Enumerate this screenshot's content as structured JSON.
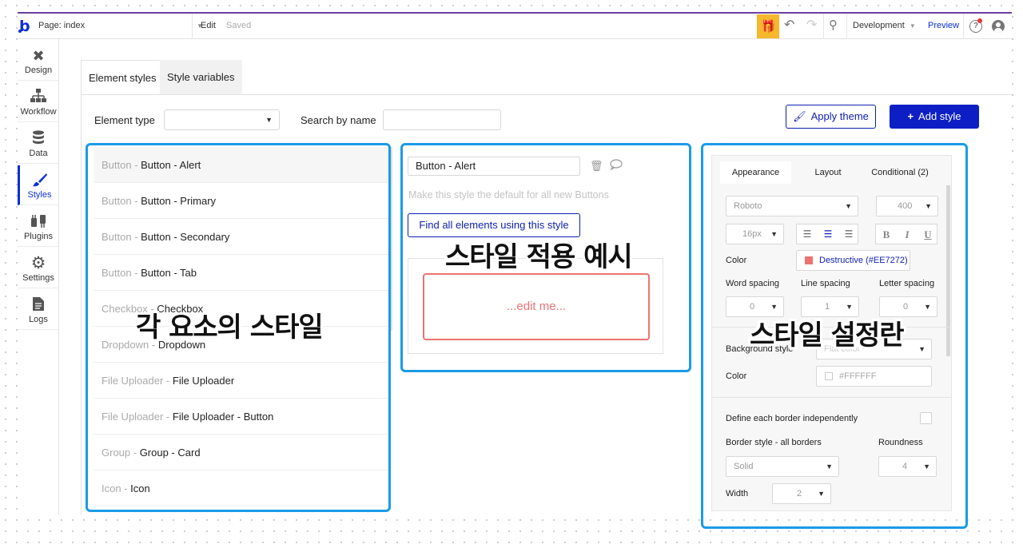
{
  "topbar": {
    "page_label": "Page: index",
    "edit_label": "Edit",
    "saved_label": "Saved",
    "environment": "Development",
    "preview_label": "Preview",
    "help_glyph": "?"
  },
  "sidebar": {
    "items": [
      {
        "label": "Design",
        "icon": "design-icon"
      },
      {
        "label": "Workflow",
        "icon": "workflow-icon"
      },
      {
        "label": "Data",
        "icon": "data-icon"
      },
      {
        "label": "Styles",
        "icon": "brush-icon",
        "active": true
      },
      {
        "label": "Plugins",
        "icon": "plug-icon"
      },
      {
        "label": "Settings",
        "icon": "gear-icon"
      },
      {
        "label": "Logs",
        "icon": "document-icon"
      }
    ]
  },
  "tabs": {
    "element_styles": "Element styles",
    "style_variables": "Style variables"
  },
  "filters": {
    "element_type_label": "Element type",
    "element_type_value": "",
    "search_label": "Search by name",
    "search_value": ""
  },
  "actions": {
    "apply_theme": "Apply theme",
    "add_style": "Add style"
  },
  "style_list": [
    {
      "type": "Button - ",
      "name": "Button - Alert",
      "selected": true
    },
    {
      "type": "Button - ",
      "name": "Button - Primary"
    },
    {
      "type": "Button - ",
      "name": "Button - Secondary"
    },
    {
      "type": "Button - ",
      "name": "Button - Tab"
    },
    {
      "type": "Checkbox - ",
      "name": "Checkbox"
    },
    {
      "type": "Dropdown - ",
      "name": "Dropdown"
    },
    {
      "type": "File Uploader - ",
      "name": "File Uploader"
    },
    {
      "type": "File Uploader - ",
      "name": "File Uploader - Button"
    },
    {
      "type": "Group - ",
      "name": "Group - Card"
    },
    {
      "type": "Icon - ",
      "name": "Icon"
    }
  ],
  "preview": {
    "style_name": "Button - Alert",
    "default_text": "Make this style the default for all new Buttons",
    "find_button": "Find all elements using this style",
    "sample_text": "...edit me..."
  },
  "panel": {
    "tabs": [
      "Appearance",
      "Layout",
      "Conditional (2)"
    ],
    "font_family": "Roboto",
    "font_weight": "400",
    "font_size": "16px",
    "color_label": "Color",
    "text_color_name": "Destructive (#EE7272)",
    "text_color_hex": "#EE7272",
    "word_spacing_label": "Word spacing",
    "line_spacing_label": "Line spacing",
    "letter_spacing_label": "Letter spacing",
    "word_spacing": "0",
    "line_spacing": "1",
    "letter_spacing": "0",
    "background_style_label": "Background style",
    "background_style": "Flat color",
    "bg_color_label": "Color",
    "bg_color": "#FFFFFF",
    "border_independent_label": "Define each border independently",
    "border_style_label": "Border style - all borders",
    "border_style": "Solid",
    "roundness_label": "Roundness",
    "roundness": "4",
    "width_label": "Width",
    "width": "2"
  },
  "captions": {
    "list": "각 요소의 스타일",
    "preview": "스타일 적용 예시",
    "settings": "스타일 설정란"
  },
  "colors": {
    "brand": "#0d1fc4",
    "highlight": "#1a9be8",
    "destructive": "#EE7272",
    "gift": "#f5b72b"
  }
}
